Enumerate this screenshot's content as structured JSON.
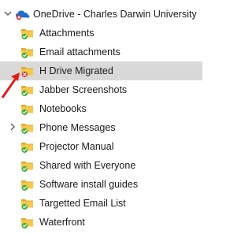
{
  "tree": {
    "root": {
      "label": "OneDrive - Charles Darwin University",
      "icon": "onedrive-cloud-icon",
      "expanded": true
    },
    "items": [
      {
        "label": "Attachments",
        "status": "synced",
        "expandable": false,
        "selected": false
      },
      {
        "label": "Email attachments",
        "status": "synced",
        "expandable": false,
        "selected": false
      },
      {
        "label": "H Drive Migrated",
        "status": "error",
        "expandable": false,
        "selected": true
      },
      {
        "label": "Jabber Screenshots",
        "status": "synced",
        "expandable": false,
        "selected": false
      },
      {
        "label": "Notebooks",
        "status": "synced",
        "expandable": false,
        "selected": false
      },
      {
        "label": "Phone Messages",
        "status": "synced",
        "expandable": true,
        "selected": false
      },
      {
        "label": "Projector Manual",
        "status": "synced",
        "expandable": false,
        "selected": false
      },
      {
        "label": "Shared with Everyone",
        "status": "synced",
        "expandable": false,
        "selected": false
      },
      {
        "label": "Software install guides",
        "status": "synced",
        "expandable": false,
        "selected": false
      },
      {
        "label": "Targetted Email List",
        "status": "synced",
        "expandable": false,
        "selected": false
      },
      {
        "label": "Waterfront",
        "status": "synced",
        "expandable": false,
        "selected": false
      }
    ]
  },
  "colors": {
    "selection": "#d9d9d9",
    "folder": "#f5c94c",
    "folder_dark": "#dcaa2e",
    "sync_ok": "#3fae3a",
    "sync_error": "#d13438",
    "annotation_arrow": "#e02020"
  }
}
